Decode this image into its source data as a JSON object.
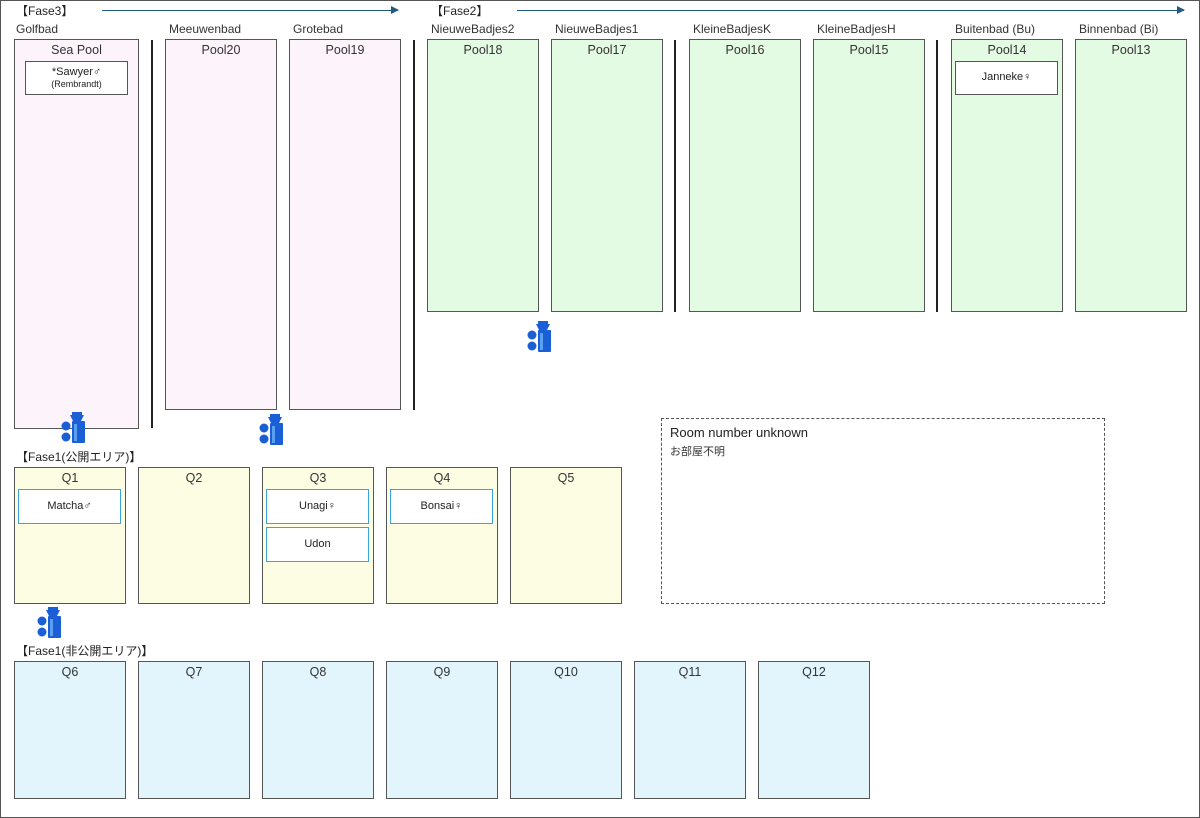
{
  "phases": {
    "fase3": "【Fase3】",
    "fase2": "【Fase2】",
    "fase1_public": "【Fase1(公開エリア)】",
    "fase1_private": "【Fase1(非公開エリア)】"
  },
  "areas": {
    "golfbad": "Golfbad",
    "meeuwenbad": "Meeuwenbad",
    "grotebad": "Grotebad",
    "nieuwebadjes2": "NieuweBadjes2",
    "nieuwebadjes1": "NieuweBadjes1",
    "kleinebadjesk": "KleineBadjesK",
    "kleinebadjesh": "KleineBadjesH",
    "buitenbad": "Buitenbad (Bu)",
    "binnenbad": "Binnenbad (Bi)"
  },
  "pools": {
    "sea_pool": "Sea Pool",
    "pool20": "Pool20",
    "pool19": "Pool19",
    "pool18": "Pool18",
    "pool17": "Pool17",
    "pool16": "Pool16",
    "pool15": "Pool15",
    "pool14": "Pool14",
    "pool13": "Pool13",
    "q1": "Q1",
    "q2": "Q2",
    "q3": "Q3",
    "q4": "Q4",
    "q5": "Q5",
    "q6": "Q6",
    "q7": "Q7",
    "q8": "Q8",
    "q9": "Q9",
    "q10": "Q10",
    "q11": "Q11",
    "q12": "Q12"
  },
  "animals": {
    "sawyer": "*Sawyer♂",
    "sawyer_note": "(Rembrandt)",
    "janneke": "Janneke♀",
    "matcha": "Matcha♂",
    "unagi": "Unagi♀",
    "udon": "Udon",
    "bonsai": "Bonsai♀"
  },
  "unknown": {
    "title": "Room number unknown",
    "subtitle": "お部屋不明"
  },
  "colors": {
    "fase3_pools": "#fdf3fb",
    "fase2_pools": "#e3fae3",
    "fase1_public_pools": "#fdfde3",
    "fase1_private_pools": "#e3f5fc",
    "camera": "#1a5fd6",
    "arrow": "#1f5a85",
    "tag_highlight_border": "#3aa6d8"
  }
}
